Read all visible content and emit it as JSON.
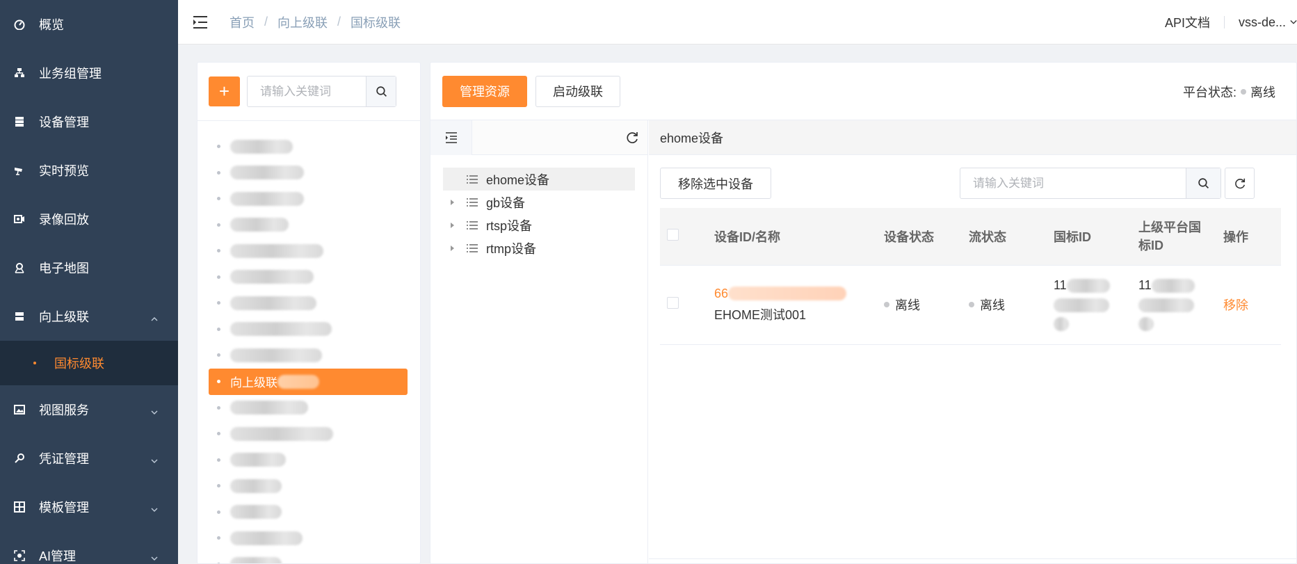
{
  "sidebar": {
    "items": [
      {
        "label": "概览",
        "icon": "dashboard-icon"
      },
      {
        "label": "业务组管理",
        "icon": "org-tree-icon"
      },
      {
        "label": "设备管理",
        "icon": "server-icon"
      },
      {
        "label": "实时预览",
        "icon": "camera-icon"
      },
      {
        "label": "录像回放",
        "icon": "video-playback-icon"
      },
      {
        "label": "电子地图",
        "icon": "map-pin-icon"
      },
      {
        "label": "向上级联",
        "icon": "cascade-icon"
      }
    ],
    "sub_active": "国标级联",
    "items_after": [
      {
        "label": "视图服务",
        "icon": "image-icon"
      },
      {
        "label": "凭证管理",
        "icon": "key-icon"
      },
      {
        "label": "模板管理",
        "icon": "template-icon"
      },
      {
        "label": "AI管理",
        "icon": "ai-icon"
      }
    ]
  },
  "header": {
    "breadcrumb": [
      "首页",
      "向上级联",
      "国标级联"
    ],
    "api_doc": "API文档",
    "user": "vss-de..."
  },
  "left_panel": {
    "add_label": "+",
    "search_placeholder": "请输入关键词",
    "active_item": "向上级联"
  },
  "main": {
    "btn_manage": "管理资源",
    "btn_start": "启动级联",
    "platform_status_label": "平台状态:",
    "platform_status_value": "离线",
    "tree": [
      {
        "label": "ehome设备",
        "expandable": false,
        "selected": true
      },
      {
        "label": "gb设备",
        "expandable": true,
        "selected": false
      },
      {
        "label": "rtsp设备",
        "expandable": true,
        "selected": false
      },
      {
        "label": "rtmp设备",
        "expandable": true,
        "selected": false
      }
    ],
    "right_title": "ehome设备",
    "btn_remove_selected": "移除选中设备",
    "search_placeholder": "请输入关键词",
    "table": {
      "headers": [
        "设备ID/名称",
        "设备状态",
        "流状态",
        "国标ID",
        "上级平台国标ID",
        "操作"
      ],
      "rows": [
        {
          "id_prefix": "66",
          "name": "EHOME测试001",
          "device_status": "离线",
          "stream_status": "离线",
          "gb_id_prefix": "11",
          "parent_id_prefix": "11",
          "action": "移除"
        }
      ]
    }
  },
  "colors": {
    "accent": "#ff8a30",
    "sidebar_bg": "#304156",
    "sidebar_sub_bg": "#1f2d3d"
  }
}
